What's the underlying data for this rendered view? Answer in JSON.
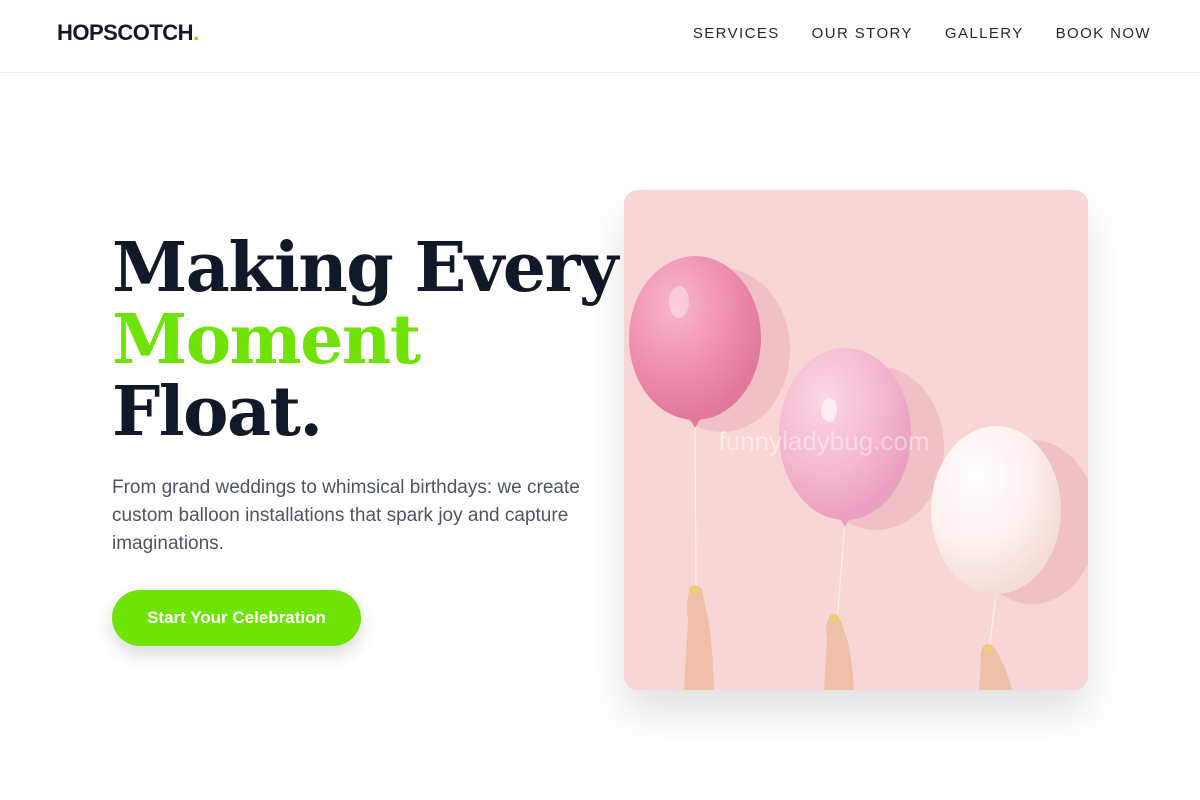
{
  "brand": {
    "name": "HOPSCOTCH",
    "dot": ".",
    "accent_color": "#6ee304"
  },
  "nav": {
    "items": [
      {
        "label": "SERVICES"
      },
      {
        "label": "OUR STORY"
      },
      {
        "label": "GALLERY"
      },
      {
        "label": "BOOK NOW"
      }
    ]
  },
  "hero": {
    "headline_line1": "Making Every",
    "headline_line2": "Moment",
    "headline_line3": "Float.",
    "description": "From grand weddings to whimsical birthdays: we create custom balloon installations that spark joy and capture imaginations.",
    "cta_label": "Start Your Celebration",
    "image_watermark": "funnyladybug.com"
  }
}
